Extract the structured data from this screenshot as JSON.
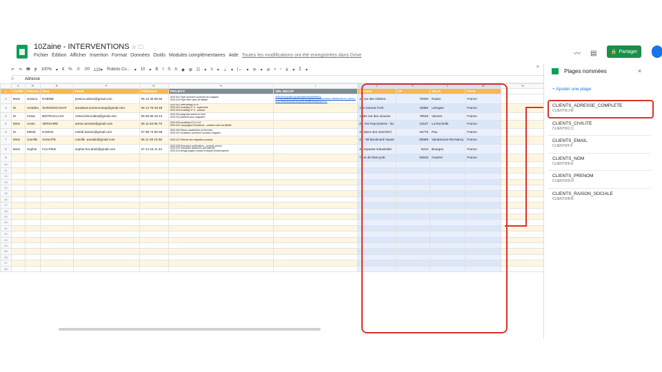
{
  "app": {
    "title": "10Zaine - INTERVENTIONS",
    "title_icons": "☆ 🗀",
    "menu": [
      "Fichier",
      "Édition",
      "Afficher",
      "Insertion",
      "Format",
      "Données",
      "Outils",
      "Modules complémentaires",
      "Aide"
    ],
    "saved_status": "Toutes les modifications ont été enregistrées dans Drive",
    "share_label": "Partager",
    "share_icon": "lock-icon"
  },
  "toolbar": {
    "items": [
      "↶",
      "↷",
      "🖶",
      "⁋",
      "100%",
      "▾",
      "€",
      "%",
      ".0",
      ".00",
      "123▾",
      "Roboto Co...",
      "▾",
      "10",
      "▾",
      "B",
      "I",
      "S",
      "A",
      "◆",
      "⊞",
      "☷",
      "▾",
      "≡",
      "▾",
      "⊥",
      "▾",
      "|↔",
      "▾",
      "⟳",
      "▾",
      "⊖",
      "▪",
      "▫",
      "⊻",
      "▾",
      "Σ",
      "▾"
    ],
    "collapse": "^"
  },
  "formula_bar": {
    "fx": "fx",
    "value": "Adresse"
  },
  "columns": [
    "C",
    "D",
    "E",
    "F",
    "G",
    "H",
    "I",
    "J",
    "K",
    "L",
    "M",
    "N"
  ],
  "header_row": [
    "Civilité",
    "Prénom",
    "Nom",
    "Email",
    "Téléphone",
    "PROJETS",
    "URL RECAP",
    "Adresse",
    "CP",
    "VILLE",
    "PAYS",
    ""
  ],
  "rows": [
    {
      "n": "2",
      "civ": "Mme",
      "prenom": "Jessica",
      "nom": "RABINE",
      "email": "jessica.rabine@gmail.com",
      "tel": "06 13 45 88 55",
      "projets": "2020-001 Flyer annonce ouverture du magasin\n2020-015 Flyer offre carte de fidélité",
      "url": "https://docs.google.com/spreadsheets/d/e/2PACX-1vT5ZeCHwRGs71sEUHflJLgZCF8bgNuFcDHyuLLe3SeReV78RWflw35mZm_r8a4zm-4mvTCZRH4ZnpubhtmI/pub?id=200851403&single=true",
      "adresse": "15 rue des Oliviers",
      "cp": "70000",
      "ville": "Rodez",
      "pays": "France"
    },
    {
      "n": "3",
      "civ": "M.",
      "prenom": "Amadeu",
      "nom": "SURSONCANAP",
      "email": "amadeus.sursoncanap@gmail.com",
      "tel": "06 14 78 48 48",
      "projets": "2020-002 Web design SITE\n2020-003 emailling N° 5 - septembre\n2020-009 emailling N° 6 - octobre",
      "url": "",
      "adresse": "125 Avenue Foch",
      "cp": "15980",
      "ville": "Limoges",
      "pays": "France"
    },
    {
      "n": "4",
      "civ": "M.",
      "prenom": "César",
      "nom": "BIZTRUCLAHA",
      "email": "césar.biztruclaha@gmail.com",
      "tel": "06 58 95 26 44",
      "projets": "2020-004 plaquette automne hiver\n2020-011 publicité pour magazine",
      "url": "",
      "adresse": "12Bis rue des acacias",
      "cp": "78545",
      "ville": "Vannes",
      "pays": "France"
    },
    {
      "n": "5",
      "civ": "Mme",
      "prenom": "Annie",
      "nom": "VERSAIRE",
      "email": "annie.versaire@gmail.com",
      "tel": "06 11 84 85 79",
      "projets": "2020-005 emailling N°12 à 15\n2020-010 Campagne Promotions - création carte de fidélité",
      "url": "",
      "adresse": "ZI - les Fauconniers - ba",
      "cp": "13107",
      "ville": "La Rochelle",
      "pays": "France"
    },
    {
      "n": "6",
      "civ": "M.",
      "prenom": "Mehdi",
      "nom": "KAMAN",
      "email": "mehdi.kaman@gmail.com",
      "tel": "07 88 74 85 96",
      "projets": "2020-006 Menus sandwiches et formules\n2020-007 invitations ouverture nouveau magasin",
      "url": "",
      "adresse": "48 place des marchés l",
      "cp": "16775",
      "ville": "Pau",
      "pays": "France"
    },
    {
      "n": "7",
      "civ": "Mme",
      "prenom": "Camille",
      "nom": "AUNAITE",
      "email": "camille .aunaite@gmail.com",
      "tel": "06 11 00 15 08",
      "projets": "2020-012 Refonte des étiquettes produits",
      "url": "",
      "adresse": "47 - 89 Boulevard Hauss",
      "cp": "80989",
      "ville": "Vandoeuvre-lès-Nancy",
      "pays": "France"
    },
    {
      "n": "8",
      "civ": "Mme",
      "prenom": "Sophie",
      "nom": "Fon-Phek",
      "email": "sophie.fon-phek@gmail.com",
      "tel": "07 14 18 11 23",
      "projets": "2020-008 Panneaux publicitaires - produits promo\n2020-013 Panneaux annonces site Internet\n2020-014 Design pages contact et départ d'ordonnances",
      "url": "",
      "adresse": "39 impasse Industrielle",
      "cp": "5210",
      "ville": "Bourges",
      "pays": "France"
    },
    {
      "n": "9",
      "civ": "",
      "prenom": "",
      "nom": "",
      "email": "",
      "tel": "",
      "projets": "",
      "url": "",
      "adresse": "7 rue de New-york",
      "cp": "64815",
      "ville": "Auxerre",
      "pays": "France"
    }
  ],
  "empty_rows": [
    "10",
    "11",
    "12",
    "13",
    "14",
    "15",
    "16",
    "17",
    "18",
    "19",
    "20",
    "21",
    "22",
    "23",
    "24",
    "25",
    "26",
    "27",
    "28"
  ],
  "panel": {
    "title": "Plages nommées",
    "close": "×",
    "add": "+ Ajouter une plage",
    "ranges": [
      {
        "name": "CLIENTS_ADRESSE_COMPLETE",
        "range": "CLIENTS!J:M"
      },
      {
        "name": "CLIENTS_CIVILITE",
        "range": "CLIENTS!C:C"
      },
      {
        "name": "CLIENTS_EMAIL",
        "range": "CLIENTS!F:F"
      },
      {
        "name": "CLIENTS_NOM",
        "range": "CLIENTS!E:E"
      },
      {
        "name": "CLIENTS_PRENOM",
        "range": "CLIENTS!D:D"
      },
      {
        "name": "CLIENTS_RAISON_SOCIALE",
        "range": "CLIENTS!B:B"
      }
    ]
  },
  "colors": {
    "header_orange": "#f6b94e",
    "header_gray": "#7e8c96",
    "highlight_red": "#d93025",
    "share_green": "#1a8f4a"
  }
}
